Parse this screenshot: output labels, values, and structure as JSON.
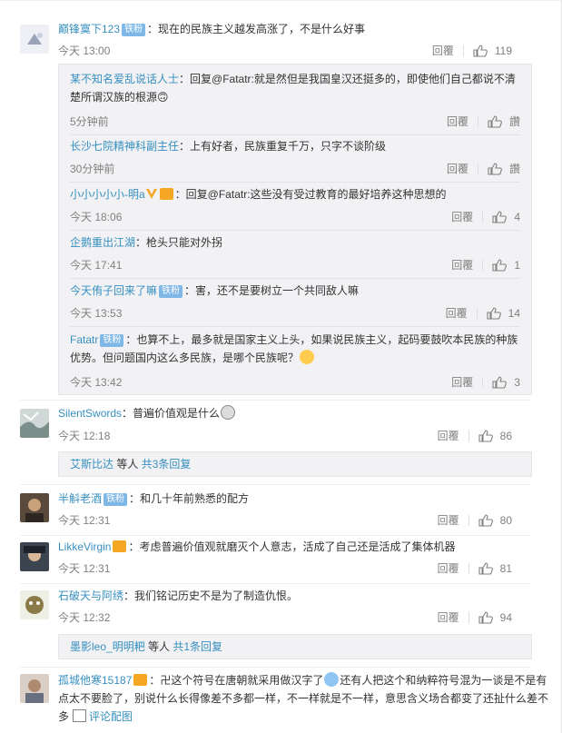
{
  "comments": [
    {
      "user": "巅锋寞下123",
      "badge": "铁粉",
      "text": "：现在的民族主义越发高涨了，不是什么好事",
      "time": "今天 13:00",
      "reply": "回覆",
      "likes": "119",
      "replies": [
        {
          "user": "某不知名爱乱说话人士",
          "text": "：回复@Fatatr:就是然但是我国皇汉还挺多的，即使他们自己都说不清楚所谓汉族的根源🙃",
          "time": "5分钟前",
          "reply": "回覆",
          "likes": "讚"
        },
        {
          "user": "长沙七院精神科副主任",
          "text": "：上有好者，民族重复千万，只字不谈阶级",
          "time": "30分钟前",
          "reply": "回覆",
          "likes": "讚"
        },
        {
          "user": "小小小小小-明a",
          "text": "：回复@Fatatr:这些没有受过教育的最好培养这种思想的",
          "time": "今天 18:06",
          "reply": "回覆",
          "likes": "4"
        },
        {
          "user": "企鹅重出江湖",
          "text": "：枪头只能对外拐",
          "time": "今天 17:41",
          "reply": "回覆",
          "likes": "1"
        },
        {
          "user": "今天侑子回来了嘛",
          "badge": "铁粉",
          "text": "：害，还不是要树立一个共同敌人嘛",
          "time": "今天 13:53",
          "reply": "回覆",
          "likes": "14"
        },
        {
          "user": "Fatatr",
          "badge": "铁粉",
          "text": "：也算不上，最多就是国家主义上头，如果说民族主义，起码要鼓吹本民族的种族优势。但问题国内这么多民族，是哪个民族呢？",
          "time": "今天 13:42",
          "reply": "回覆",
          "likes": "3"
        }
      ]
    },
    {
      "user": "SilentSwords",
      "text": "：普遍价值观是什么",
      "time": "今天 12:18",
      "reply": "回覆",
      "likes": "86",
      "more": {
        "users": "艾斯比达",
        "mid": " 等人 ",
        "tail": "共3条回复"
      }
    },
    {
      "user": "半斛老酒",
      "badge": "铁粉",
      "text": "：和几十年前熟悉的配方",
      "time": "今天 12:31",
      "reply": "回覆",
      "likes": "80"
    },
    {
      "user": "LikkeVirgin",
      "text": "：考虑普遍价值观就磨灭个人意志，活成了自己还是活成了集体机器",
      "time": "今天 12:31",
      "reply": "回覆",
      "likes": "81"
    },
    {
      "user": "石破天与阿绣",
      "text": "：我们铭记历史不是为了制造仇恨。",
      "time": "今天 12:32",
      "reply": "回覆",
      "likes": "94",
      "more": {
        "users": "墨影leo_明明粑",
        "mid": " 等人 ",
        "tail": "共1条回复"
      }
    },
    {
      "user": "孤城他寒15187",
      "text": "：卍这个符号在唐朝就采用做汉字了",
      "text2": "还有人把这个和纳粹符号混为一谈是不是有点太不要脸了，别说什么长得像差不多都一样，不一样就是不一样，意思含义场合都变了还扯什么差不多",
      "link": "评论配图"
    }
  ]
}
